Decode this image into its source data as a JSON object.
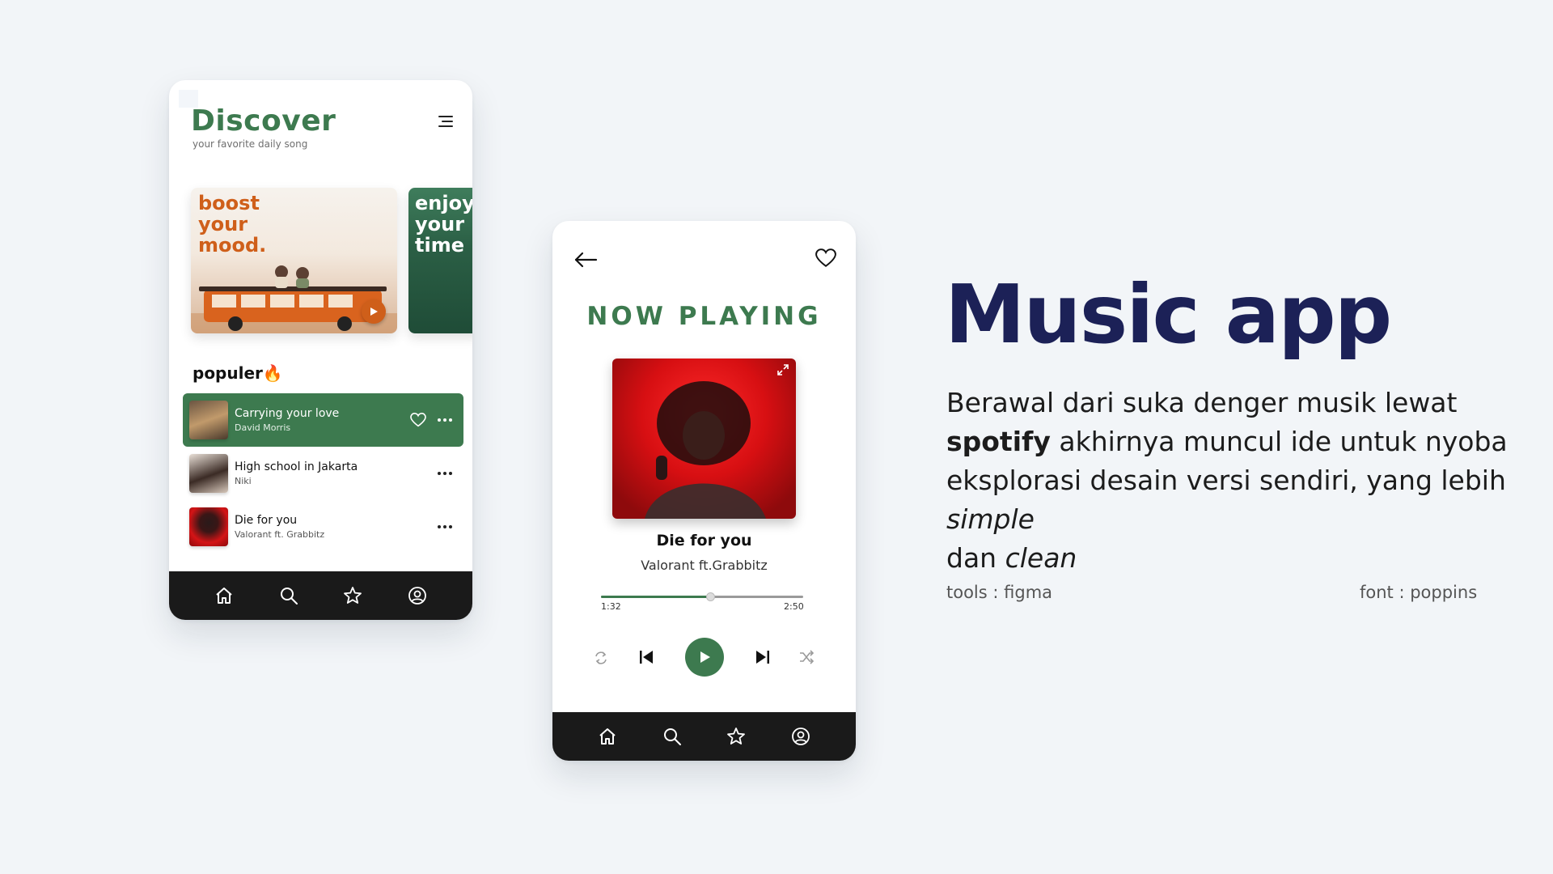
{
  "discover": {
    "title": "Discover",
    "subtitle": "your favorite daily song",
    "banners": [
      {
        "text_lines": [
          "boost",
          "your",
          "mood."
        ]
      },
      {
        "text_lines": [
          "enjoy",
          "your",
          "time"
        ]
      }
    ],
    "section_title": "populer🔥",
    "songs": [
      {
        "title": "Carrying your love",
        "artist": "David Morris",
        "active": true
      },
      {
        "title": "High school in Jakarta",
        "artist": "Niki",
        "active": false
      },
      {
        "title": "Die for you",
        "artist": "Valorant ft. Grabbitz",
        "active": false
      }
    ]
  },
  "player": {
    "header": "NOW PLAYING",
    "song": "Die for you",
    "artist": "Valorant ft.Grabbitz",
    "elapsed": "1:32",
    "duration": "2:50",
    "progress_fraction": 0.54
  },
  "hero": {
    "title": "Music app",
    "desc_part1": "Berawal dari suka denger musik lewat ",
    "desc_bold": "spotify",
    "desc_part2": " akhirnya muncul ide untuk nyoba eksplorasi desain versi sendiri, yang lebih ",
    "desc_italic1": "simple",
    "desc_part3": " dan ",
    "desc_italic2": "clean",
    "tools": "tools : figma",
    "font": "font : poppins"
  },
  "colors": {
    "accent_green": "#3d7a4f",
    "accent_orange": "#cf5f1a",
    "title_navy": "#1c2157",
    "tabbar": "#1a1a1a"
  },
  "icons": {
    "tabs": [
      "home-icon",
      "search-icon",
      "star-icon",
      "profile-icon"
    ]
  }
}
